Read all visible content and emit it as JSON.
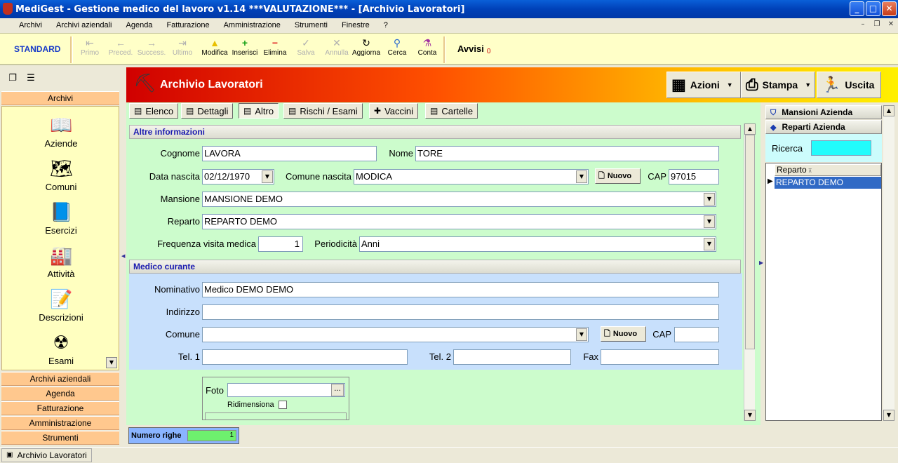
{
  "window": {
    "title": "MediGest - Gestione medico del lavoro v1.14 ***VALUTAZIONE*** - [Archivio Lavoratori]",
    "min": "_",
    "max": "□",
    "close": "✕"
  },
  "menu": [
    "Archivi",
    "Archivi aziendali",
    "Agenda",
    "Fatturazione",
    "Amministrazione",
    "Strumenti",
    "Finestre",
    "?"
  ],
  "toolbar": {
    "profile": "STANDARD",
    "buttons": [
      {
        "label": "Primo",
        "icon": "⇤",
        "enabled": false
      },
      {
        "label": "Preced.",
        "icon": "←",
        "enabled": false
      },
      {
        "label": "Success.",
        "icon": "→",
        "enabled": false
      },
      {
        "label": "Ultimo",
        "icon": "⇥",
        "enabled": false
      },
      {
        "label": "Modifica",
        "icon": "▲",
        "enabled": true
      },
      {
        "label": "Inserisci",
        "icon": "+",
        "enabled": true
      },
      {
        "label": "Elimina",
        "icon": "−",
        "enabled": true
      },
      {
        "label": "Salva",
        "icon": "✓",
        "enabled": false
      },
      {
        "label": "Annulla",
        "icon": "✕",
        "enabled": false
      },
      {
        "label": "Aggiorna",
        "icon": "↻",
        "enabled": true
      },
      {
        "label": "Cerca",
        "icon": "⚲",
        "enabled": true
      },
      {
        "label": "Conta",
        "icon": "⚗",
        "enabled": true
      }
    ],
    "avvisi_label": "Avvisi",
    "avvisi_count": "0"
  },
  "left": {
    "archivi_header": "Archivi",
    "items": [
      {
        "label": "Aziende",
        "icon": "📖"
      },
      {
        "label": "Comuni",
        "icon": "🗺"
      },
      {
        "label": "Esercizi",
        "icon": "📘"
      },
      {
        "label": "Attività",
        "icon": "🏭"
      },
      {
        "label": "Descrizioni",
        "icon": "📝"
      },
      {
        "label": "Esami",
        "icon": "☢"
      }
    ],
    "groups": [
      "Archivi aziendali",
      "Agenda",
      "Fatturazione",
      "Amministrazione",
      "Strumenti"
    ]
  },
  "header": {
    "title": "Archivio Lavoratori",
    "azioni": "Azioni",
    "stampa": "Stampa",
    "uscita": "Uscita"
  },
  "tabs": [
    "Elenco",
    "Dettagli",
    "Altro",
    "Rischi / Esami",
    "Vaccini",
    "Cartelle"
  ],
  "altre": {
    "section": "Altre informazioni",
    "cognome_label": "Cognome",
    "cognome": "LAVORA",
    "nome_label": "Nome",
    "nome": "TORE",
    "data_label": "Data nascita",
    "data": "02/12/1970",
    "comune_label": "Comune nascita",
    "comune": "MODICA",
    "nuovo": "Nuovo",
    "cap_label": "CAP",
    "cap": "97015",
    "mansione_label": "Mansione",
    "mansione": "MANSIONE DEMO",
    "reparto_label": "Reparto",
    "reparto": "REPARTO DEMO",
    "freq_label": "Frequenza visita medica",
    "freq": "1",
    "period_label": "Periodicità",
    "period": "Anni"
  },
  "medico": {
    "section": "Medico curante",
    "nominativo_label": "Nominativo",
    "nominativo": "Medico DEMO DEMO",
    "indirizzo_label": "Indirizzo",
    "indirizzo": "",
    "comune_label": "Comune",
    "comune": "",
    "nuovo": "Nuovo",
    "cap_label": "CAP",
    "cap": "",
    "tel1_label": "Tel. 1",
    "tel1": "",
    "tel2_label": "Tel. 2",
    "tel2": "",
    "fax_label": "Fax",
    "fax": ""
  },
  "foto": {
    "label": "Foto",
    "value": "",
    "browse": "...",
    "ridimensiona": "Ridimensiona"
  },
  "footer": {
    "numero_righe": "Numero righe",
    "count": "1"
  },
  "right": {
    "mansioni": "Mansioni Azienda",
    "reparti": "Reparti Azienda",
    "ricerca": "Ricerca",
    "column": "Reparto",
    "rows": [
      "REPARTO DEMO"
    ]
  },
  "status": {
    "task": "Archivio Lavoratori"
  }
}
